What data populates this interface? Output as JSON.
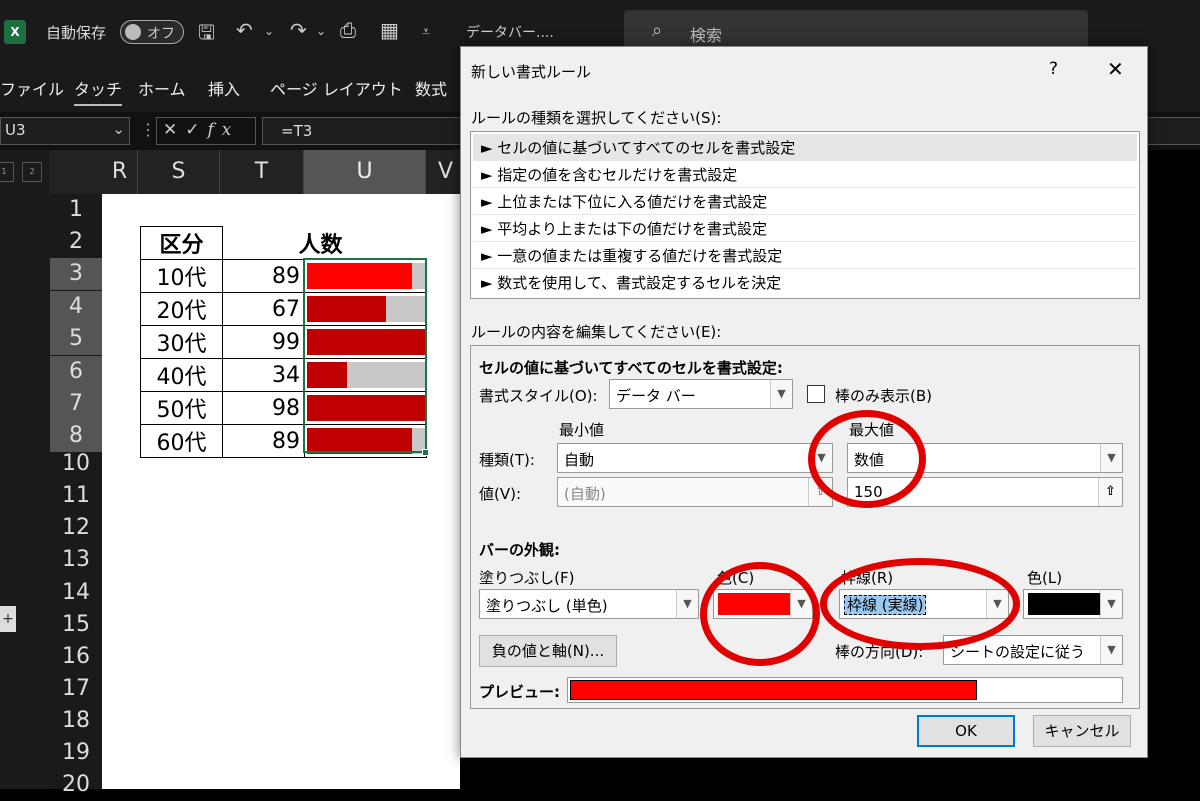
{
  "titlebar": {
    "logo": "X",
    "autosave_label": "自動保存",
    "autosave_state": "オフ",
    "doc_title": "データバー....",
    "search_placeholder": "検索"
  },
  "ribbon": {
    "tabs": [
      "ファイル",
      "タッチ",
      "ホーム",
      "挿入",
      "ページ レイアウト",
      "数式"
    ],
    "active_tab": "タッチ"
  },
  "formula_bar": {
    "name_box": "U3",
    "formula": "=T3"
  },
  "grid": {
    "group_buttons": [
      "1",
      "2"
    ],
    "columns": [
      "R",
      "S",
      "T",
      "U",
      "V"
    ],
    "selected_column": "U",
    "rows": [
      "1",
      "2",
      "3",
      "4",
      "5",
      "6",
      "7",
      "8",
      "10",
      "11",
      "12",
      "13",
      "14",
      "15",
      "16",
      "17",
      "18",
      "19",
      "20"
    ],
    "table": {
      "header_col1": "区分",
      "header_col2": "人数",
      "rows": [
        {
          "label": "10代",
          "value": "89",
          "fill": 0.89
        },
        {
          "label": "20代",
          "value": "67",
          "fill": 0.67
        },
        {
          "label": "30代",
          "value": "99",
          "fill": 1.0
        },
        {
          "label": "40代",
          "value": "34",
          "fill": 0.34
        },
        {
          "label": "50代",
          "value": "98",
          "fill": 1.0
        },
        {
          "label": "60代",
          "value": "89",
          "fill": 0.89
        }
      ]
    }
  },
  "dialog": {
    "title": "新しい書式ルール",
    "help": "?",
    "close": "✕",
    "rule_type_label": "ルールの種類を選択してください(S):",
    "rule_types": [
      "► セルの値に基づいてすべてのセルを書式設定",
      "► 指定の値を含むセルだけを書式設定",
      "► 上位または下位に入る値だけを書式設定",
      "► 平均より上または下の値だけを書式設定",
      "► 一意の値または重複する値だけを書式設定",
      "► 数式を使用して、書式設定するセルを決定"
    ],
    "edit_label": "ルールの内容を編集してください(E):",
    "section_title": "セルの値に基づいてすべてのセルを書式設定:",
    "format_style_label": "書式スタイル(O):",
    "format_style_value": "データ バー",
    "bar_only_label": "棒のみ表示(B)",
    "min_label": "最小値",
    "max_label": "最大値",
    "type_label": "種類(T):",
    "value_label": "値(V):",
    "min_type": "自動",
    "max_type": "数値",
    "min_value": "(自動)",
    "max_value": "150",
    "appearance_label": "バーの外観:",
    "fill_label": "塗りつぶし(F)",
    "fill_value": "塗りつぶし (単色)",
    "fill_color_label": "色(C)",
    "fill_color": "#ff0000",
    "border_label": "枠線(R)",
    "border_value": "枠線 (実線)",
    "border_color_label": "色(L)",
    "border_color": "#000000",
    "negative_button": "負の値と軸(N)...",
    "direction_label": "棒の方向(D):",
    "direction_value": "シートの設定に従う",
    "preview_label": "プレビュー:",
    "preview_fill": 0.74,
    "ok": "OK",
    "cancel": "キャンセル"
  }
}
